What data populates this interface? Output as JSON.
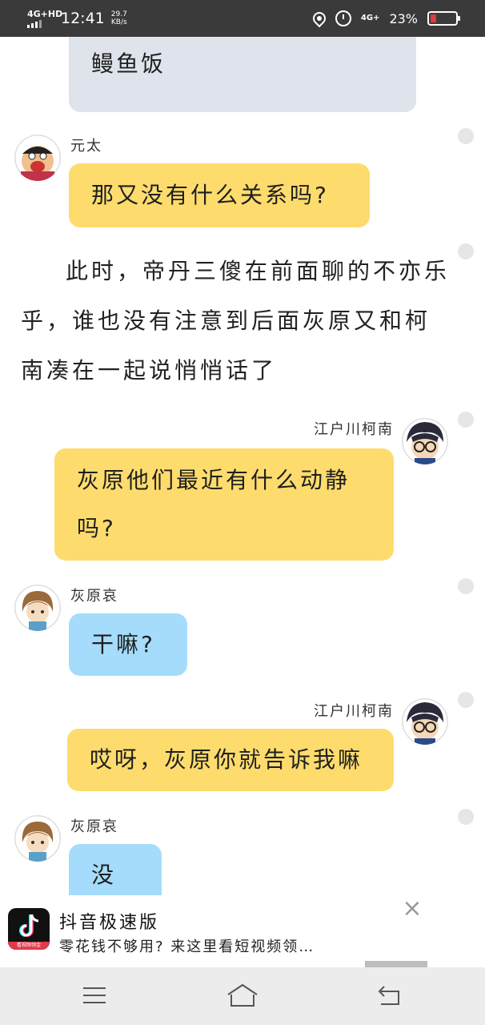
{
  "status_bar": {
    "network": "4G+HD",
    "time": "12:41",
    "speed_value": "29.7",
    "speed_unit": "KB/s",
    "network_right": "4G+",
    "battery_percent": "23%",
    "battery_level": 0.23,
    "battery_color": "#e03a3a"
  },
  "chat": {
    "messages": [
      {
        "type": "bubble-partial",
        "color": "gray",
        "text": "鳗鱼饭"
      },
      {
        "sender": "元太",
        "side": "left",
        "color": "yellow",
        "text": "那又没有什么关系吗?",
        "avatar": "genta-avatar"
      },
      {
        "type": "narration",
        "text": "此时，帝丹三傻在前面聊的不亦乐乎，谁也没有注意到后面灰原又和柯南凑在一起说悄悄话了"
      },
      {
        "sender": "江户川柯南",
        "side": "right",
        "color": "yellow",
        "text_line1": "灰原他们最近有什么动静",
        "text_line2": "吗?",
        "avatar": "conan-avatar"
      },
      {
        "sender": "灰原哀",
        "side": "left",
        "color": "blue",
        "text": "干嘛?",
        "avatar": "haibara-avatar"
      },
      {
        "sender": "江户川柯南",
        "side": "right",
        "color": "yellow",
        "text": "哎呀，灰原你就告诉我嘛",
        "avatar": "conan-avatar"
      },
      {
        "sender": "灰原哀",
        "side": "left",
        "color": "blue",
        "text": "没有",
        "avatar": "haibara-avatar"
      }
    ]
  },
  "ad": {
    "title": "抖音极速版",
    "subtitle": "零花钱不够用? 来这里看短视频领…",
    "logo_strip": "看视频领金",
    "close_label": "×"
  },
  "colors": {
    "yellow_bubble": "#fddc6d",
    "blue_bubble": "#a5dcfb",
    "gray_bubble": "#dfe4ec"
  }
}
